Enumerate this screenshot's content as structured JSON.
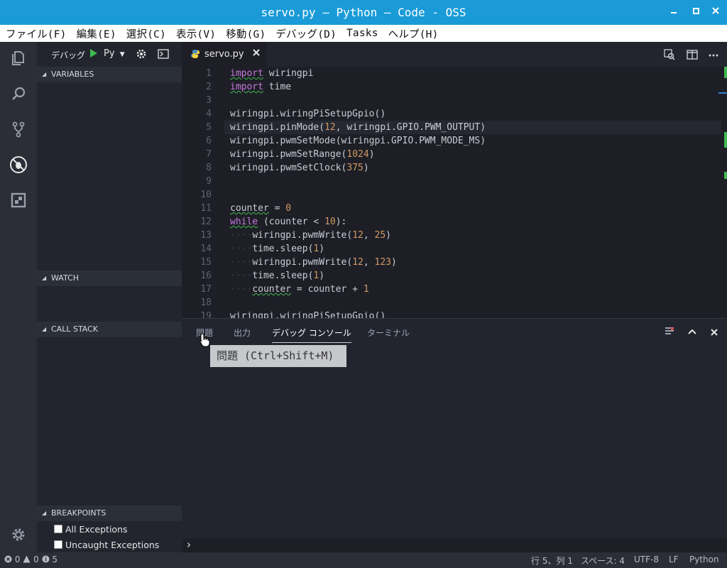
{
  "window": {
    "title": "servo.py — Python — Code - OSS"
  },
  "menu": [
    "ファイル(F)",
    "編集(E)",
    "選択(C)",
    "表示(V)",
    "移動(G)",
    "デバッグ(D)",
    "Tasks",
    "ヘルプ(H)"
  ],
  "debug_toolbar": {
    "label": "デバッグ",
    "config": "Py"
  },
  "sidebar": {
    "variables": "VARIABLES",
    "watch": "WATCH",
    "call_stack": "CALL STACK",
    "breakpoints": "BREAKPOINTS",
    "breakpoint_items": [
      {
        "label": "All Exceptions",
        "checked": false
      },
      {
        "label": "Uncaught Exceptions",
        "checked": false
      }
    ]
  },
  "editor": {
    "tab_label": "servo.py",
    "lines": [
      {
        "n": "1",
        "text": "import wiringpi"
      },
      {
        "n": "2",
        "text": "import time"
      },
      {
        "n": "3",
        "text": ""
      },
      {
        "n": "4",
        "text": "wiringpi.wiringPiSetupGpio()"
      },
      {
        "n": "5",
        "text": "wiringpi.pinMode(12, wiringpi.GPIO.PWM_OUTPUT)"
      },
      {
        "n": "6",
        "text": "wiringpi.pwmSetMode(wiringpi.GPIO.PWM_MODE_MS)"
      },
      {
        "n": "7",
        "text": "wiringpi.pwmSetRange(1024)"
      },
      {
        "n": "8",
        "text": "wiringpi.pwmSetClock(375)"
      },
      {
        "n": "9",
        "text": ""
      },
      {
        "n": "10",
        "text": ""
      },
      {
        "n": "11",
        "text": "counter = 0"
      },
      {
        "n": "12",
        "text": "while (counter < 10):"
      },
      {
        "n": "13",
        "text": "    wiringpi.pwmWrite(12, 25)"
      },
      {
        "n": "14",
        "text": "    time.sleep(1)"
      },
      {
        "n": "15",
        "text": "    wiringpi.pwmWrite(12, 123)"
      },
      {
        "n": "16",
        "text": "    time.sleep(1)"
      },
      {
        "n": "17",
        "text": "    counter = counter + 1"
      },
      {
        "n": "18",
        "text": ""
      },
      {
        "n": "19",
        "text": "wiringpi.wiringPiSetupGpio()"
      }
    ]
  },
  "panel": {
    "tabs": [
      "問題",
      "出力",
      "デバッグ コンソール",
      "ターミナル"
    ],
    "active_tab": "デバッグ コンソール",
    "tooltip": "問題 (Ctrl+Shift+M)",
    "prompt": "›"
  },
  "status": {
    "errors": "0",
    "warnings": "0",
    "infos": "5",
    "position": "行 5、列 1",
    "indent": "スペース: 4",
    "encoding": "UTF-8",
    "eol": "LF",
    "language": "Python"
  },
  "colors": {
    "titlebar": "#1a9bd7",
    "keyword": "#c678dd",
    "number": "#d19a66",
    "run": "#3fb950"
  }
}
